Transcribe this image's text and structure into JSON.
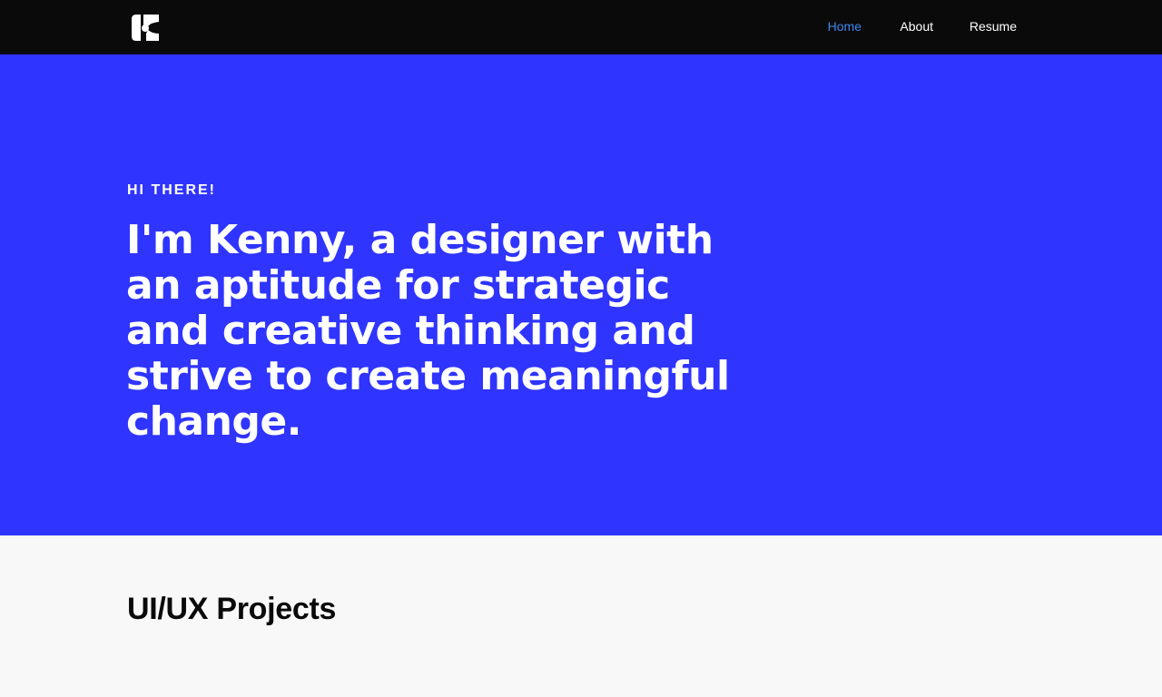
{
  "header": {
    "logo_icon": "k-logo-icon",
    "nav": [
      {
        "label": "Home",
        "active": true
      },
      {
        "label": "About",
        "active": false
      },
      {
        "label": "Resume",
        "active": false
      }
    ]
  },
  "hero": {
    "eyebrow": "HI THERE!",
    "intro_prefix": "I'm ",
    "name": "Kenny,",
    "intro_rest": " a designer with an aptitude for strategic and creative thinking and strive to create meaningful change."
  },
  "projects": {
    "title": "UI/UX Projects"
  },
  "colors": {
    "topbar": "#0a0a0a",
    "hero_bg": "#2f34ff",
    "nav_active": "#3b87f0",
    "page_bg": "#f8f8f8"
  }
}
